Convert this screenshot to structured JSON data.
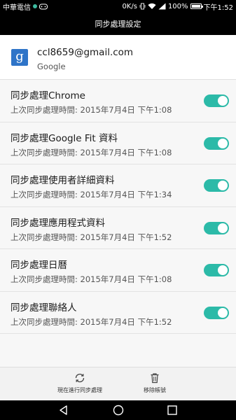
{
  "status_bar": {
    "carrier": "中華電信",
    "speed": "0K/s",
    "battery": "100%",
    "time": "下午1:52"
  },
  "header": {
    "title": "同步處理設定"
  },
  "account": {
    "icon": "google-g-icon",
    "email": "ccl8659@gmail.com",
    "type": "Google"
  },
  "sync_items": [
    {
      "title": "同步處理Chrome",
      "last_sync": "上次同步處理時間:  2015年7月4日 下午1:08",
      "enabled": true
    },
    {
      "title": "同步處理Google Fit 資料",
      "last_sync": "上次同步處理時間:  2015年7月4日 下午1:08",
      "enabled": true
    },
    {
      "title": "同步處理使用者詳細資料",
      "last_sync": "上次同步處理時間:  2015年7月4日 下午1:34",
      "enabled": true
    },
    {
      "title": "同步處理應用程式資料",
      "last_sync": "上次同步處理時間:  2015年7月4日 下午1:52",
      "enabled": true
    },
    {
      "title": "同步處理日曆",
      "last_sync": "上次同步處理時間:  2015年7月4日 下午1:08",
      "enabled": true
    },
    {
      "title": "同步處理聯絡人",
      "last_sync": "上次同步處理時間:  2015年7月4日 下午1:52",
      "enabled": true
    }
  ],
  "actions": {
    "sync_now": "現在進行同步處理",
    "remove_account": "移除帳號"
  },
  "colors": {
    "toggle_on": "#2cbaa8",
    "google_icon": "#2e74c8"
  }
}
